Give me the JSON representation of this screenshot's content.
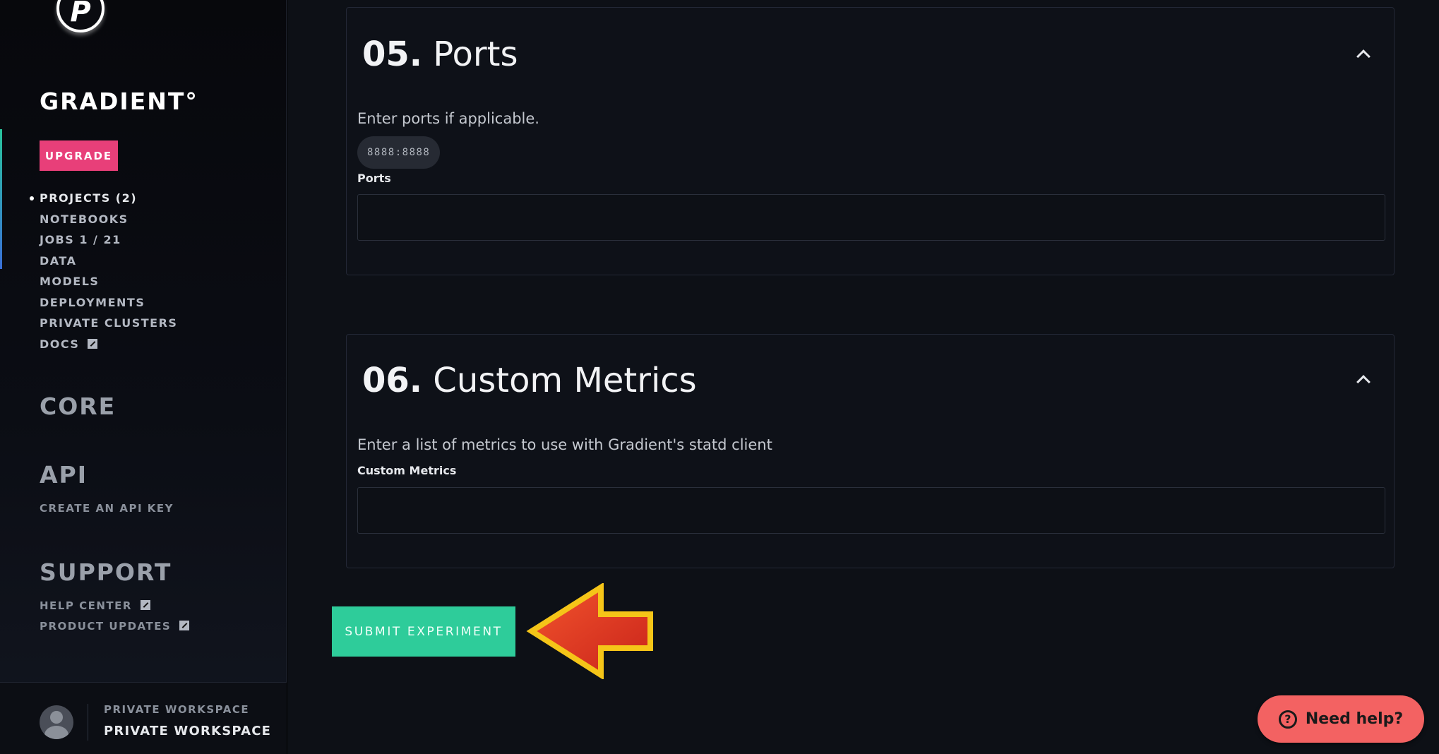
{
  "sidebar": {
    "logo_letter": "P",
    "brand": "GRADIENT°",
    "upgrade_label": "UPGRADE",
    "nav": [
      {
        "label": "PROJECTS (2)",
        "active": true
      },
      {
        "label": "NOTEBOOKS"
      },
      {
        "label": "JOBS 1 / 21"
      },
      {
        "label": "DATA"
      },
      {
        "label": "MODELS"
      },
      {
        "label": "DEPLOYMENTS"
      },
      {
        "label": "PRIVATE CLUSTERS"
      },
      {
        "label": "DOCS",
        "icon": "external-link-icon"
      }
    ],
    "core_title": "CORE",
    "api_title": "API",
    "api_link": "CREATE AN API KEY",
    "support_title": "SUPPORT",
    "support_links": [
      {
        "label": "HELP CENTER",
        "icon": "external-link-icon"
      },
      {
        "label": "PRODUCT UPDATES",
        "icon": "external-link-icon"
      }
    ],
    "workspace_small": "PRIVATE WORKSPACE",
    "workspace_big": "PRIVATE WORKSPACE"
  },
  "sections": {
    "ports": {
      "number": "05.",
      "title": "Ports",
      "description": "Enter ports if applicable.",
      "chip": "8888:8888",
      "field_label": "Ports",
      "value": ""
    },
    "metrics": {
      "number": "06.",
      "title": "Custom Metrics",
      "description": "Enter a list of metrics to use with Gradient's statd client",
      "field_label": "Custom Metrics",
      "value": ""
    }
  },
  "submit_label": "SUBMIT EXPERIMENT",
  "help_label": "Need help?",
  "help_icon_glyph": "?",
  "colors": {
    "accent_green": "#2ecc9a",
    "upgrade_pink": "#e83f79",
    "help_red": "#f36262",
    "arrow_red": "#e63c1e",
    "arrow_outline": "#f5c518"
  }
}
